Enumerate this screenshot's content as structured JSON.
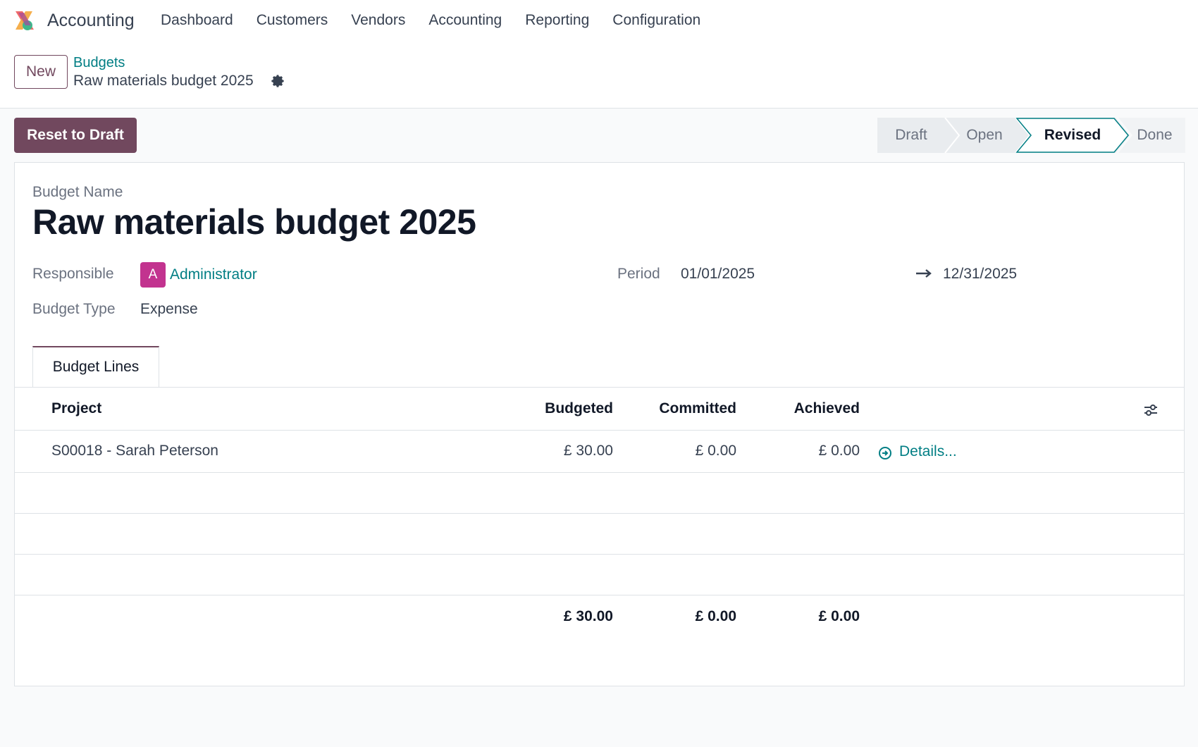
{
  "app": {
    "name": "Accounting",
    "logo_icon": "odoo-accounting-logo"
  },
  "nav": [
    "Dashboard",
    "Customers",
    "Vendors",
    "Accounting",
    "Reporting",
    "Configuration"
  ],
  "control": {
    "new_label": "New",
    "breadcrumb_parent": "Budgets",
    "breadcrumb_current": "Raw materials budget 2025"
  },
  "actions": {
    "reset_label": "Reset to Draft"
  },
  "status": {
    "stages": [
      "Draft",
      "Open",
      "Revised",
      "Done"
    ],
    "active": "Revised"
  },
  "form": {
    "name_label": "Budget Name",
    "name_value": "Raw materials budget 2025",
    "responsible_label": "Responsible",
    "responsible_initial": "A",
    "responsible_value": "Administrator",
    "period_label": "Period",
    "period_start": "01/01/2025",
    "period_end": "12/31/2025",
    "type_label": "Budget Type",
    "type_value": "Expense"
  },
  "tabs": {
    "budget_lines": "Budget Lines"
  },
  "table": {
    "headers": {
      "project": "Project",
      "budgeted": "Budgeted",
      "committed": "Committed",
      "achieved": "Achieved"
    },
    "rows": [
      {
        "project": "S00018 - Sarah Peterson",
        "budgeted": "£ 30.00",
        "committed": "£ 0.00",
        "achieved": "£ 0.00",
        "details": "Details..."
      }
    ],
    "totals": {
      "budgeted": "£ 30.00",
      "committed": "£ 0.00",
      "achieved": "£ 0.00"
    }
  },
  "colors": {
    "brand": "#71485e",
    "link": "#017e84",
    "avatar": "#c2338f"
  }
}
